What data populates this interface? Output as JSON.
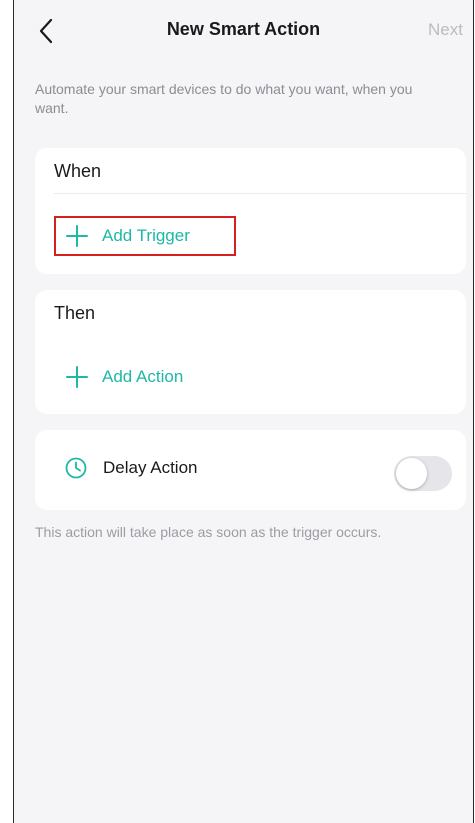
{
  "nav": {
    "title": "New Smart Action",
    "next_label": "Next",
    "back_icon": "chevron-left-icon"
  },
  "description": "Automate your smart devices to do what you want, when you want.",
  "when_section": {
    "title": "When",
    "add_label": "Add Trigger",
    "add_icon": "plus-icon"
  },
  "then_section": {
    "title": "Then",
    "add_label": "Add Action",
    "add_icon": "plus-icon"
  },
  "delay": {
    "label": "Delay Action",
    "icon": "clock-icon",
    "enabled": false,
    "hint": "This action will take place as soon as the trigger occurs."
  },
  "colors": {
    "accent": "#1fb7a6",
    "highlight_border": "#d6201f",
    "background": "#f5f5f7",
    "disabled_text": "#b9bcc1"
  }
}
